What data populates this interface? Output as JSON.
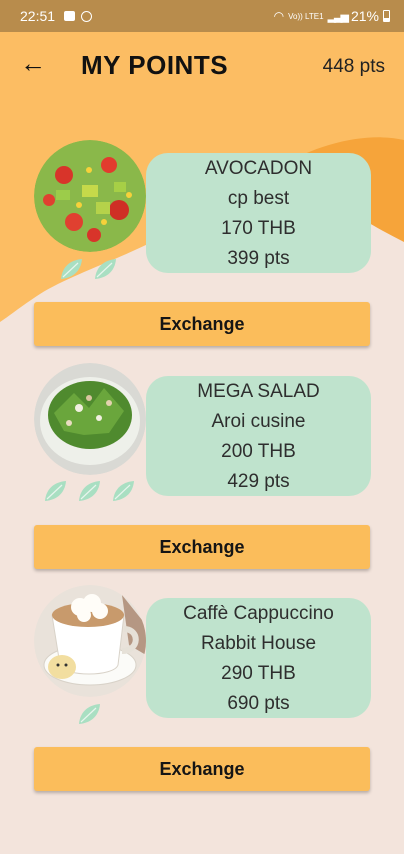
{
  "status_bar": {
    "time": "22:51",
    "network": "Vo)) LTE1",
    "battery": "21%"
  },
  "header": {
    "back_icon": "←",
    "title": "MY POINTS",
    "points": "448 pts"
  },
  "items": [
    {
      "name": "AVOCADON",
      "shop": "cp best",
      "price": "170 THB",
      "points": "399 pts",
      "leaves": 2,
      "button": "Exchange",
      "image": "salad-with-tomatoes-avocado-corn"
    },
    {
      "name": "MEGA SALAD",
      "shop": "Aroi cusine",
      "price": "200 THB",
      "points": "429 pts",
      "leaves": 3,
      "button": "Exchange",
      "image": "green-salad-bowl"
    },
    {
      "name": "Caffè Cappuccino",
      "shop": "Rabbit House",
      "price": "290 THB",
      "points": "690 pts",
      "leaves": 1,
      "button": "Exchange",
      "image": "cappuccino-cup"
    }
  ],
  "colors": {
    "background": "#f3e4dc",
    "accent_orange": "#fbbd5b",
    "card_green": "#bfe3cd",
    "leaf_green": "#a9dfc2",
    "status_bar": "#b88c4c"
  }
}
